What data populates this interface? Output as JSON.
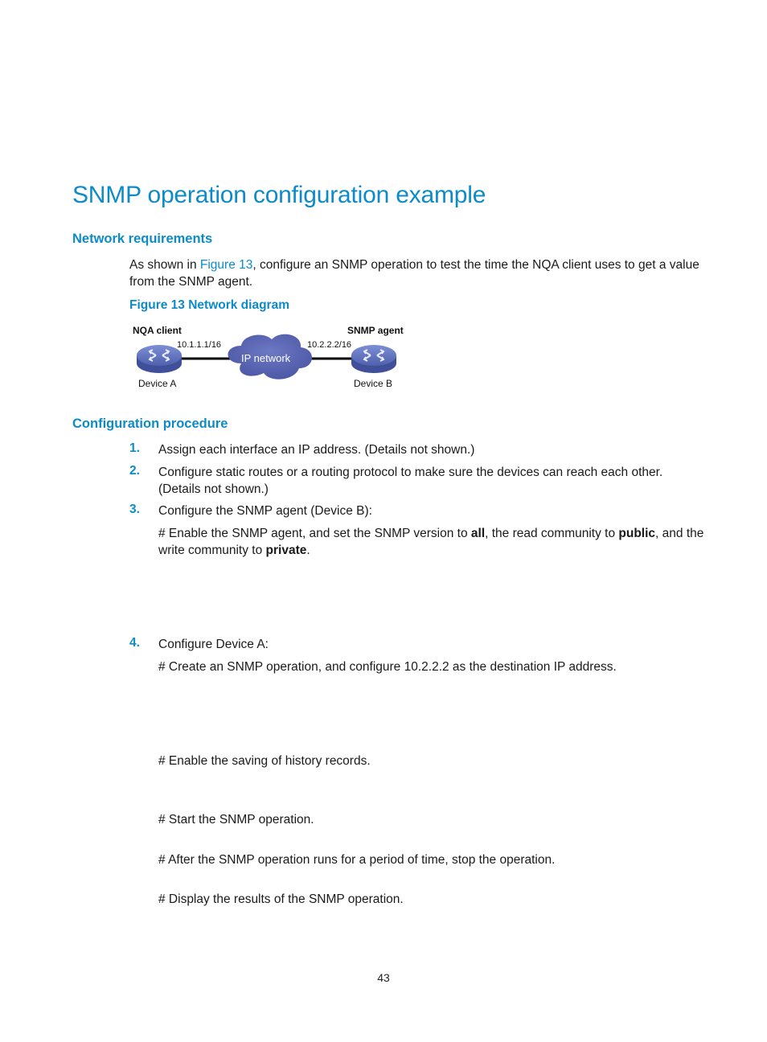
{
  "page_title": "SNMP operation configuration example",
  "sections": {
    "network_requirements": {
      "heading": "Network requirements",
      "para_prefix": "As shown in ",
      "para_link": "Figure 13",
      "para_suffix_line1": ", configure an SNMP operation to test the time the NQA client uses to get a value",
      "para_line2": "from the SNMP agent.",
      "figure_caption": "Figure 13 Network diagram"
    },
    "configuration_procedure": {
      "heading": "Configuration procedure",
      "steps": [
        {
          "num": "1.",
          "text": "Assign each interface an IP address. (Details not shown.)"
        },
        {
          "num": "2.",
          "text_line1": "Configure static routes or a routing protocol to make sure the devices can reach each other.",
          "text_line2": "(Details not shown.)"
        },
        {
          "num": "3.",
          "text": "Configure the SNMP agent (Device B):",
          "comment_a": "# Enable the SNMP agent, and set the SNMP version to ",
          "bold_all": "all",
          "comment_b": ", the read community to ",
          "bold_public": "public",
          "comment_c": ", and the",
          "comment_line2_a": "write community to ",
          "bold_private": "private",
          "comment_line2_b": "."
        },
        {
          "num": "4.",
          "text": "Configure Device A:",
          "comments": [
            "# Create an SNMP operation, and configure 10.2.2.2 as the destination IP address.",
            "# Enable the saving of history records.",
            "# Start the SNMP operation.",
            "# After the SNMP operation runs for a period of time, stop the operation.",
            "# Display the results of the SNMP operation."
          ]
        }
      ]
    }
  },
  "diagram": {
    "left_role": "NQA client",
    "right_role": "SNMP agent",
    "left_ip": "10.1.1.1/16",
    "right_ip": "10.2.2.2/16",
    "cloud_label": "IP network",
    "left_device": "Device A",
    "right_device": "Device B",
    "router_color": "#5b6db8",
    "cloud_color": "#5a66b0"
  },
  "footer": {
    "page_number": "43"
  }
}
